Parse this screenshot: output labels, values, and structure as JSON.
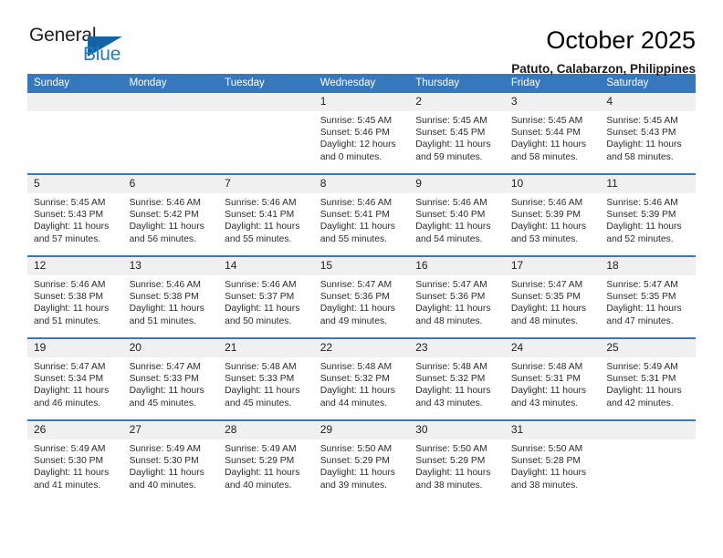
{
  "brand": {
    "word_one": "General",
    "word_two": "Blue",
    "flag_icon": "blue-triangle-flag-icon",
    "accent_color": "#1d7cc4",
    "flag_color": "#1464a5"
  },
  "header": {
    "title": "October 2025",
    "subtitle": "Patuto, Calabarzon, Philippines"
  },
  "theme": {
    "header_row_bg": "#3778bc",
    "header_row_text": "#ffffff",
    "daynum_bg": "#f0f0f0",
    "cell_border": "#3778bc"
  },
  "weekday_headers": [
    "Sunday",
    "Monday",
    "Tuesday",
    "Wednesday",
    "Thursday",
    "Friday",
    "Saturday"
  ],
  "labels": {
    "sunrise_prefix": "Sunrise:",
    "sunset_prefix": "Sunset:",
    "daylight_prefix": "Daylight:"
  },
  "weeks": [
    [
      {
        "day": "",
        "sunrise": "",
        "sunset": "",
        "daylight_line1": "",
        "daylight_line2": ""
      },
      {
        "day": "",
        "sunrise": "",
        "sunset": "",
        "daylight_line1": "",
        "daylight_line2": ""
      },
      {
        "day": "",
        "sunrise": "",
        "sunset": "",
        "daylight_line1": "",
        "daylight_line2": ""
      },
      {
        "day": "1",
        "sunrise": "Sunrise: 5:45 AM",
        "sunset": "Sunset: 5:46 PM",
        "daylight_line1": "Daylight: 12 hours",
        "daylight_line2": "and 0 minutes."
      },
      {
        "day": "2",
        "sunrise": "Sunrise: 5:45 AM",
        "sunset": "Sunset: 5:45 PM",
        "daylight_line1": "Daylight: 11 hours",
        "daylight_line2": "and 59 minutes."
      },
      {
        "day": "3",
        "sunrise": "Sunrise: 5:45 AM",
        "sunset": "Sunset: 5:44 PM",
        "daylight_line1": "Daylight: 11 hours",
        "daylight_line2": "and 58 minutes."
      },
      {
        "day": "4",
        "sunrise": "Sunrise: 5:45 AM",
        "sunset": "Sunset: 5:43 PM",
        "daylight_line1": "Daylight: 11 hours",
        "daylight_line2": "and 58 minutes."
      }
    ],
    [
      {
        "day": "5",
        "sunrise": "Sunrise: 5:45 AM",
        "sunset": "Sunset: 5:43 PM",
        "daylight_line1": "Daylight: 11 hours",
        "daylight_line2": "and 57 minutes."
      },
      {
        "day": "6",
        "sunrise": "Sunrise: 5:46 AM",
        "sunset": "Sunset: 5:42 PM",
        "daylight_line1": "Daylight: 11 hours",
        "daylight_line2": "and 56 minutes."
      },
      {
        "day": "7",
        "sunrise": "Sunrise: 5:46 AM",
        "sunset": "Sunset: 5:41 PM",
        "daylight_line1": "Daylight: 11 hours",
        "daylight_line2": "and 55 minutes."
      },
      {
        "day": "8",
        "sunrise": "Sunrise: 5:46 AM",
        "sunset": "Sunset: 5:41 PM",
        "daylight_line1": "Daylight: 11 hours",
        "daylight_line2": "and 55 minutes."
      },
      {
        "day": "9",
        "sunrise": "Sunrise: 5:46 AM",
        "sunset": "Sunset: 5:40 PM",
        "daylight_line1": "Daylight: 11 hours",
        "daylight_line2": "and 54 minutes."
      },
      {
        "day": "10",
        "sunrise": "Sunrise: 5:46 AM",
        "sunset": "Sunset: 5:39 PM",
        "daylight_line1": "Daylight: 11 hours",
        "daylight_line2": "and 53 minutes."
      },
      {
        "day": "11",
        "sunrise": "Sunrise: 5:46 AM",
        "sunset": "Sunset: 5:39 PM",
        "daylight_line1": "Daylight: 11 hours",
        "daylight_line2": "and 52 minutes."
      }
    ],
    [
      {
        "day": "12",
        "sunrise": "Sunrise: 5:46 AM",
        "sunset": "Sunset: 5:38 PM",
        "daylight_line1": "Daylight: 11 hours",
        "daylight_line2": "and 51 minutes."
      },
      {
        "day": "13",
        "sunrise": "Sunrise: 5:46 AM",
        "sunset": "Sunset: 5:38 PM",
        "daylight_line1": "Daylight: 11 hours",
        "daylight_line2": "and 51 minutes."
      },
      {
        "day": "14",
        "sunrise": "Sunrise: 5:46 AM",
        "sunset": "Sunset: 5:37 PM",
        "daylight_line1": "Daylight: 11 hours",
        "daylight_line2": "and 50 minutes."
      },
      {
        "day": "15",
        "sunrise": "Sunrise: 5:47 AM",
        "sunset": "Sunset: 5:36 PM",
        "daylight_line1": "Daylight: 11 hours",
        "daylight_line2": "and 49 minutes."
      },
      {
        "day": "16",
        "sunrise": "Sunrise: 5:47 AM",
        "sunset": "Sunset: 5:36 PM",
        "daylight_line1": "Daylight: 11 hours",
        "daylight_line2": "and 48 minutes."
      },
      {
        "day": "17",
        "sunrise": "Sunrise: 5:47 AM",
        "sunset": "Sunset: 5:35 PM",
        "daylight_line1": "Daylight: 11 hours",
        "daylight_line2": "and 48 minutes."
      },
      {
        "day": "18",
        "sunrise": "Sunrise: 5:47 AM",
        "sunset": "Sunset: 5:35 PM",
        "daylight_line1": "Daylight: 11 hours",
        "daylight_line2": "and 47 minutes."
      }
    ],
    [
      {
        "day": "19",
        "sunrise": "Sunrise: 5:47 AM",
        "sunset": "Sunset: 5:34 PM",
        "daylight_line1": "Daylight: 11 hours",
        "daylight_line2": "and 46 minutes."
      },
      {
        "day": "20",
        "sunrise": "Sunrise: 5:47 AM",
        "sunset": "Sunset: 5:33 PM",
        "daylight_line1": "Daylight: 11 hours",
        "daylight_line2": "and 45 minutes."
      },
      {
        "day": "21",
        "sunrise": "Sunrise: 5:48 AM",
        "sunset": "Sunset: 5:33 PM",
        "daylight_line1": "Daylight: 11 hours",
        "daylight_line2": "and 45 minutes."
      },
      {
        "day": "22",
        "sunrise": "Sunrise: 5:48 AM",
        "sunset": "Sunset: 5:32 PM",
        "daylight_line1": "Daylight: 11 hours",
        "daylight_line2": "and 44 minutes."
      },
      {
        "day": "23",
        "sunrise": "Sunrise: 5:48 AM",
        "sunset": "Sunset: 5:32 PM",
        "daylight_line1": "Daylight: 11 hours",
        "daylight_line2": "and 43 minutes."
      },
      {
        "day": "24",
        "sunrise": "Sunrise: 5:48 AM",
        "sunset": "Sunset: 5:31 PM",
        "daylight_line1": "Daylight: 11 hours",
        "daylight_line2": "and 43 minutes."
      },
      {
        "day": "25",
        "sunrise": "Sunrise: 5:49 AM",
        "sunset": "Sunset: 5:31 PM",
        "daylight_line1": "Daylight: 11 hours",
        "daylight_line2": "and 42 minutes."
      }
    ],
    [
      {
        "day": "26",
        "sunrise": "Sunrise: 5:49 AM",
        "sunset": "Sunset: 5:30 PM",
        "daylight_line1": "Daylight: 11 hours",
        "daylight_line2": "and 41 minutes."
      },
      {
        "day": "27",
        "sunrise": "Sunrise: 5:49 AM",
        "sunset": "Sunset: 5:30 PM",
        "daylight_line1": "Daylight: 11 hours",
        "daylight_line2": "and 40 minutes."
      },
      {
        "day": "28",
        "sunrise": "Sunrise: 5:49 AM",
        "sunset": "Sunset: 5:29 PM",
        "daylight_line1": "Daylight: 11 hours",
        "daylight_line2": "and 40 minutes."
      },
      {
        "day": "29",
        "sunrise": "Sunrise: 5:50 AM",
        "sunset": "Sunset: 5:29 PM",
        "daylight_line1": "Daylight: 11 hours",
        "daylight_line2": "and 39 minutes."
      },
      {
        "day": "30",
        "sunrise": "Sunrise: 5:50 AM",
        "sunset": "Sunset: 5:29 PM",
        "daylight_line1": "Daylight: 11 hours",
        "daylight_line2": "and 38 minutes."
      },
      {
        "day": "31",
        "sunrise": "Sunrise: 5:50 AM",
        "sunset": "Sunset: 5:28 PM",
        "daylight_line1": "Daylight: 11 hours",
        "daylight_line2": "and 38 minutes."
      },
      {
        "day": "",
        "sunrise": "",
        "sunset": "",
        "daylight_line1": "",
        "daylight_line2": ""
      }
    ]
  ]
}
